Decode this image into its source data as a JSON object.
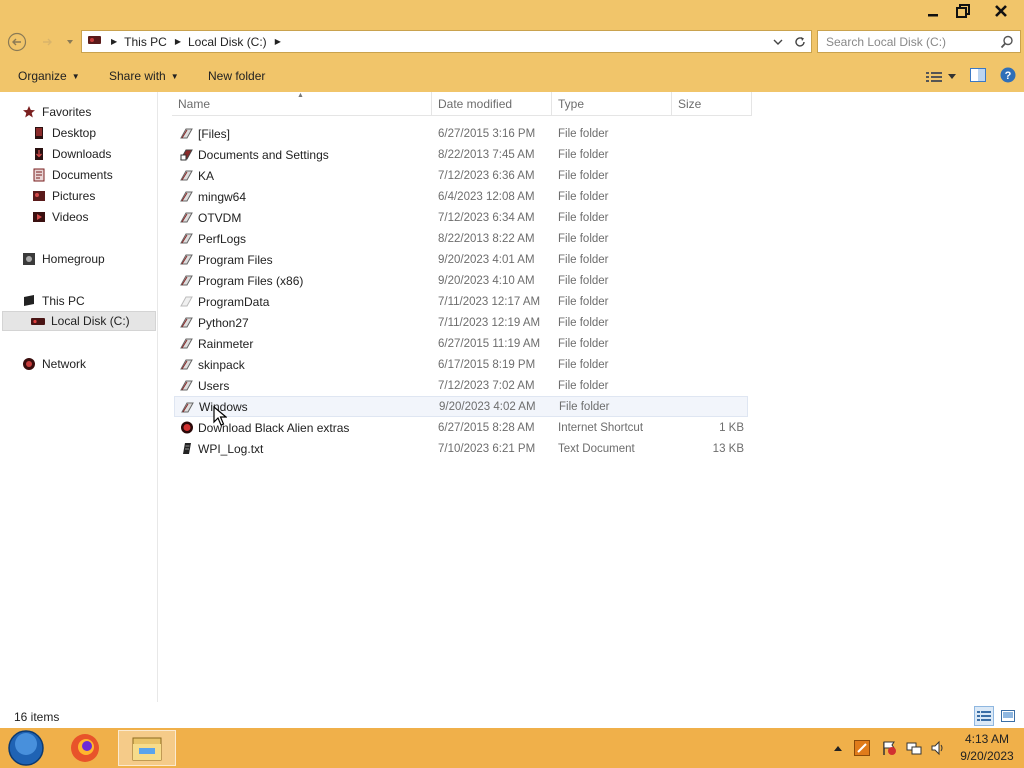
{
  "window": {
    "buttons": [
      "minimize",
      "restore",
      "close"
    ]
  },
  "address": {
    "breadcrumb": [
      "This PC",
      "Local Disk (C:)"
    ],
    "search_placeholder": "Search Local Disk (C:)"
  },
  "toolbar": {
    "organize": "Organize",
    "share_with": "Share with",
    "new_folder": "New folder"
  },
  "sidebar": {
    "favorites": "Favorites",
    "favorites_items": [
      "Desktop",
      "Downloads",
      "Documents",
      "Pictures",
      "Videos"
    ],
    "homegroup": "Homegroup",
    "this_pc": "This PC",
    "this_pc_items": [
      "Local Disk (C:)"
    ],
    "network": "Network"
  },
  "columns": {
    "name": "Name",
    "date": "Date modified",
    "type": "Type",
    "size": "Size"
  },
  "files": [
    {
      "name": "[Files]",
      "date": "6/27/2015 3:16 PM",
      "type": "File folder",
      "size": ""
    },
    {
      "name": "Documents and Settings",
      "date": "8/22/2013 7:45 AM",
      "type": "File folder",
      "size": ""
    },
    {
      "name": "KA",
      "date": "7/12/2023 6:36 AM",
      "type": "File folder",
      "size": ""
    },
    {
      "name": "mingw64",
      "date": "6/4/2023 12:08 AM",
      "type": "File folder",
      "size": ""
    },
    {
      "name": "OTVDM",
      "date": "7/12/2023 6:34 AM",
      "type": "File folder",
      "size": ""
    },
    {
      "name": "PerfLogs",
      "date": "8/22/2013 8:22 AM",
      "type": "File folder",
      "size": ""
    },
    {
      "name": "Program Files",
      "date": "9/20/2023 4:01 AM",
      "type": "File folder",
      "size": ""
    },
    {
      "name": "Program Files (x86)",
      "date": "9/20/2023 4:10 AM",
      "type": "File folder",
      "size": ""
    },
    {
      "name": "ProgramData",
      "date": "7/11/2023 12:17 AM",
      "type": "File folder",
      "size": ""
    },
    {
      "name": "Python27",
      "date": "7/11/2023 12:19 AM",
      "type": "File folder",
      "size": ""
    },
    {
      "name": "Rainmeter",
      "date": "6/27/2015 11:19 AM",
      "type": "File folder",
      "size": ""
    },
    {
      "name": "skinpack",
      "date": "6/17/2015 8:19 PM",
      "type": "File folder",
      "size": ""
    },
    {
      "name": "Users",
      "date": "7/12/2023 7:02 AM",
      "type": "File folder",
      "size": ""
    },
    {
      "name": "Windows",
      "date": "9/20/2023 4:02 AM",
      "type": "File folder",
      "size": ""
    },
    {
      "name": "Download Black Alien extras",
      "date": "6/27/2015 8:28 AM",
      "type": "Internet Shortcut",
      "size": "1 KB"
    },
    {
      "name": "WPI_Log.txt",
      "date": "7/10/2023 6:21 PM",
      "type": "Text Document",
      "size": "13 KB"
    }
  ],
  "status": {
    "item_count": "16 items"
  },
  "taskbar": {
    "time": "4:13 AM",
    "date": "9/20/2023"
  },
  "colors": {
    "chrome": "#f1c56a",
    "taskbar": "#f0b04a",
    "hover_row": "#f2f5fb"
  }
}
